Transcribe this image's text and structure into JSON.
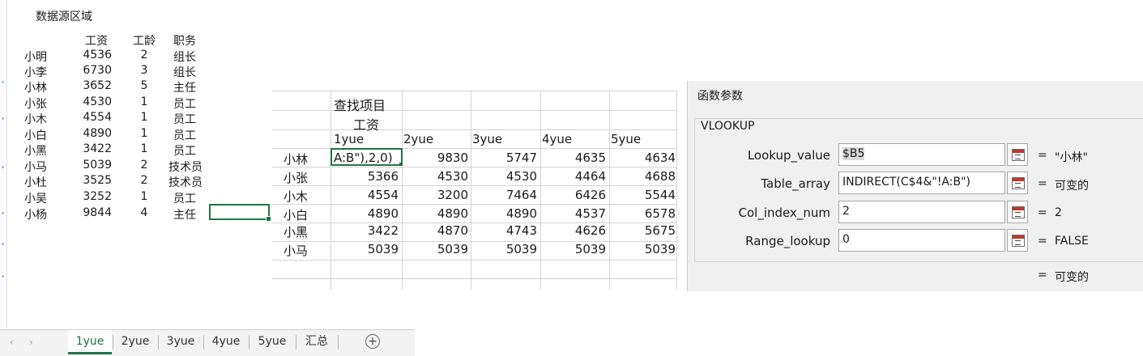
{
  "source": {
    "title": "数据源区域",
    "headers": [
      "工资",
      "工龄",
      "职务"
    ],
    "rows": [
      {
        "name": "小明",
        "salary": "4536",
        "years": "2",
        "role": "组长"
      },
      {
        "name": "小李",
        "salary": "6730",
        "years": "3",
        "role": "组长"
      },
      {
        "name": "小林",
        "salary": "3652",
        "years": "5",
        "role": "主任"
      },
      {
        "name": "小张",
        "salary": "4530",
        "years": "1",
        "role": "员工"
      },
      {
        "name": "小木",
        "salary": "4554",
        "years": "1",
        "role": "员工"
      },
      {
        "name": "小白",
        "salary": "4890",
        "years": "1",
        "role": "员工"
      },
      {
        "name": "小黑",
        "salary": "3422",
        "years": "1",
        "role": "员工"
      },
      {
        "name": "小马",
        "salary": "5039",
        "years": "2",
        "role": "技术员"
      },
      {
        "name": "小杜",
        "salary": "3525",
        "years": "2",
        "role": "技术员"
      },
      {
        "name": "小吴",
        "salary": "3252",
        "years": "1",
        "role": "员工"
      },
      {
        "name": "小杨",
        "salary": "9844",
        "years": "4",
        "role": "主任"
      }
    ]
  },
  "lookup": {
    "label_line1": "查找项目",
    "label_line2": "工资",
    "months": [
      "1yue",
      "2yue",
      "3yue",
      "4yue",
      "5yue"
    ],
    "active_cell_text": "A:B\"),2,0)",
    "rows": [
      {
        "name": "小林",
        "values": [
          "",
          "9830",
          "5747",
          "4635",
          "4634"
        ]
      },
      {
        "name": "小张",
        "values": [
          "5366",
          "4530",
          "4530",
          "4464",
          "4688"
        ]
      },
      {
        "name": "小木",
        "values": [
          "4554",
          "3200",
          "7464",
          "6426",
          "5544"
        ]
      },
      {
        "name": "小白",
        "values": [
          "4890",
          "4890",
          "4890",
          "4537",
          "6578"
        ]
      },
      {
        "name": "小黑",
        "values": [
          "3422",
          "4870",
          "4743",
          "4626",
          "5675"
        ]
      },
      {
        "name": "小马",
        "values": [
          "5039",
          "5039",
          "5039",
          "5039",
          "5039"
        ]
      }
    ]
  },
  "dialog": {
    "title": "函数参数",
    "function_name": "VLOOKUP",
    "args": [
      {
        "label": "Lookup_value",
        "value": "$B5",
        "result": "\"小林\""
      },
      {
        "label": "Table_array",
        "value": "INDIRECT(C$4&\"!A:B\")",
        "result": "可变的"
      },
      {
        "label": "Col_index_num",
        "value": "2",
        "result": "2"
      },
      {
        "label": "Range_lookup",
        "value": "0",
        "result": "FALSE"
      }
    ],
    "eq_sign": "=",
    "overall_result": "可变的"
  },
  "tabs": {
    "items": [
      "1yue",
      "2yue",
      "3yue",
      "4yue",
      "5yue",
      "汇总"
    ],
    "active": "1yue",
    "add_symbol": "+",
    "prev_symbol": "‹",
    "next_symbol": "›"
  }
}
